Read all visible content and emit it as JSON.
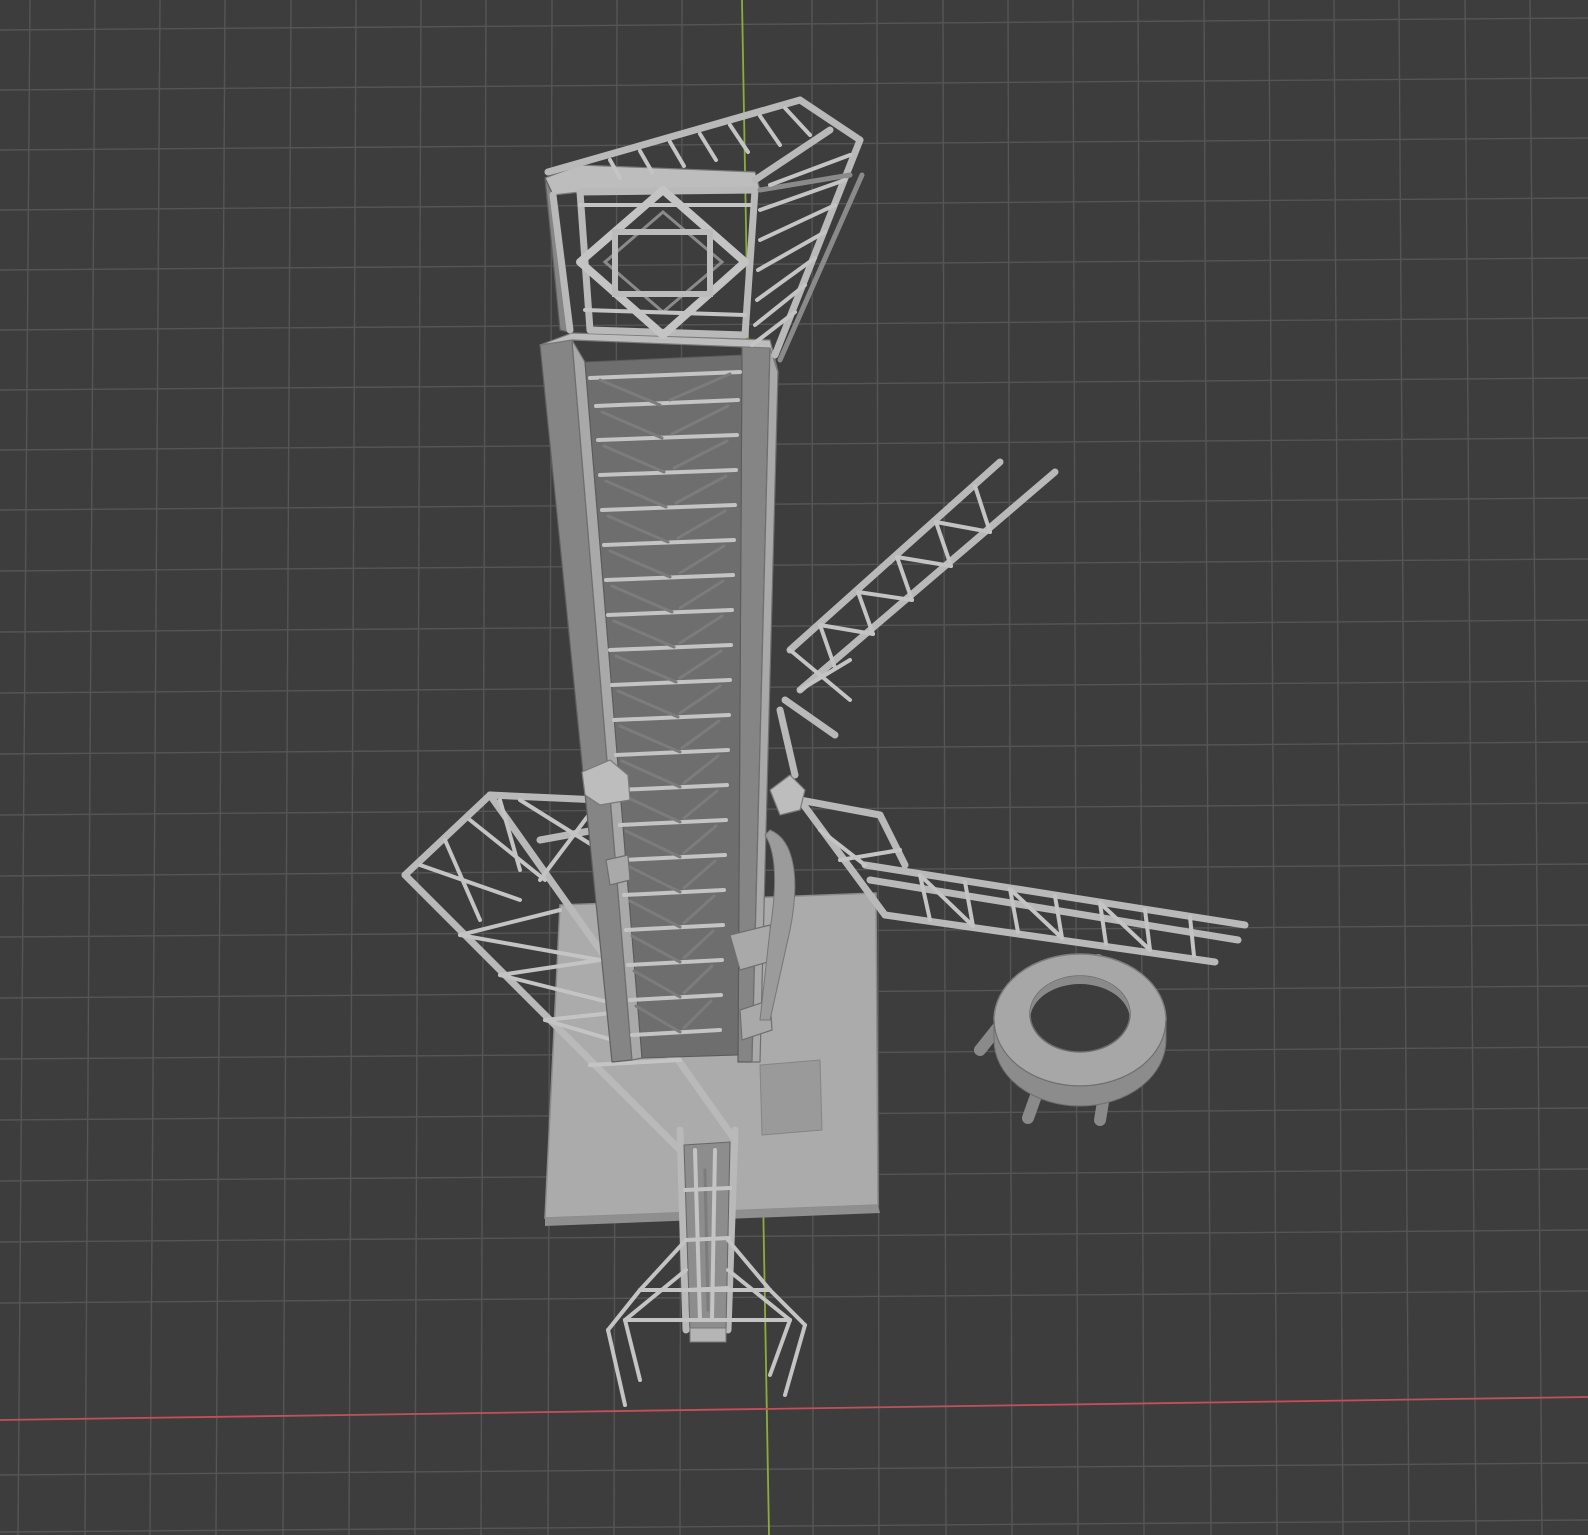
{
  "viewport": {
    "background": "#3d3d3d",
    "grid_color": "#555555",
    "x_axis_color": "#c2505a",
    "y_axis_color": "#8cad3a"
  },
  "model": {
    "material_color": "#aaaaaa"
  }
}
